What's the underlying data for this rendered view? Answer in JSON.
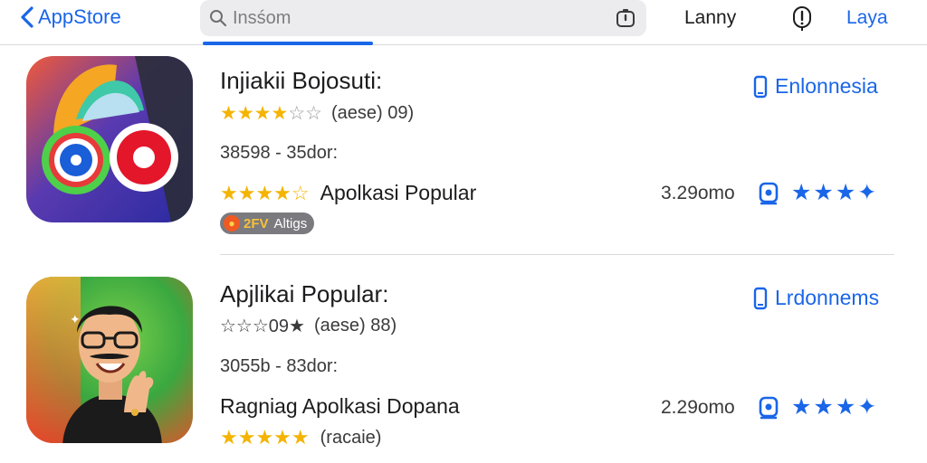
{
  "topbar": {
    "back_label": "AppStore",
    "search_placeholder": "Insśom",
    "language_label": "Lanny",
    "action_label": "Laya"
  },
  "apps": [
    {
      "title": "Injiakii Bojosuti:",
      "rating_stars": 3.5,
      "rating_text": "(aese) 09)",
      "meta": "38598 - 35dor:",
      "tagline": "Apolkasi Popular",
      "badge_code": "2FV",
      "badge_label": "Altigs",
      "region": "Enlonnesia",
      "size": "3.29omo",
      "icon": "colorful-circles-app-icon"
    },
    {
      "title": "Apjlikai Popular:",
      "rating_prefix": "☆☆☆09★",
      "rating_text": "(aese) 88)",
      "meta": "3055b - 83dor:",
      "tagline": "Ragniag Apolkasi Dopana",
      "tagline_stars": 5,
      "tagline_extra": "(racaie)",
      "region": "Lrdonnems",
      "size": "2.29omo",
      "icon": "man-avatar-app-icon"
    }
  ],
  "colors": {
    "accent": "#1a66e8",
    "star": "#f4b400",
    "badge": "#7a7a7f"
  }
}
